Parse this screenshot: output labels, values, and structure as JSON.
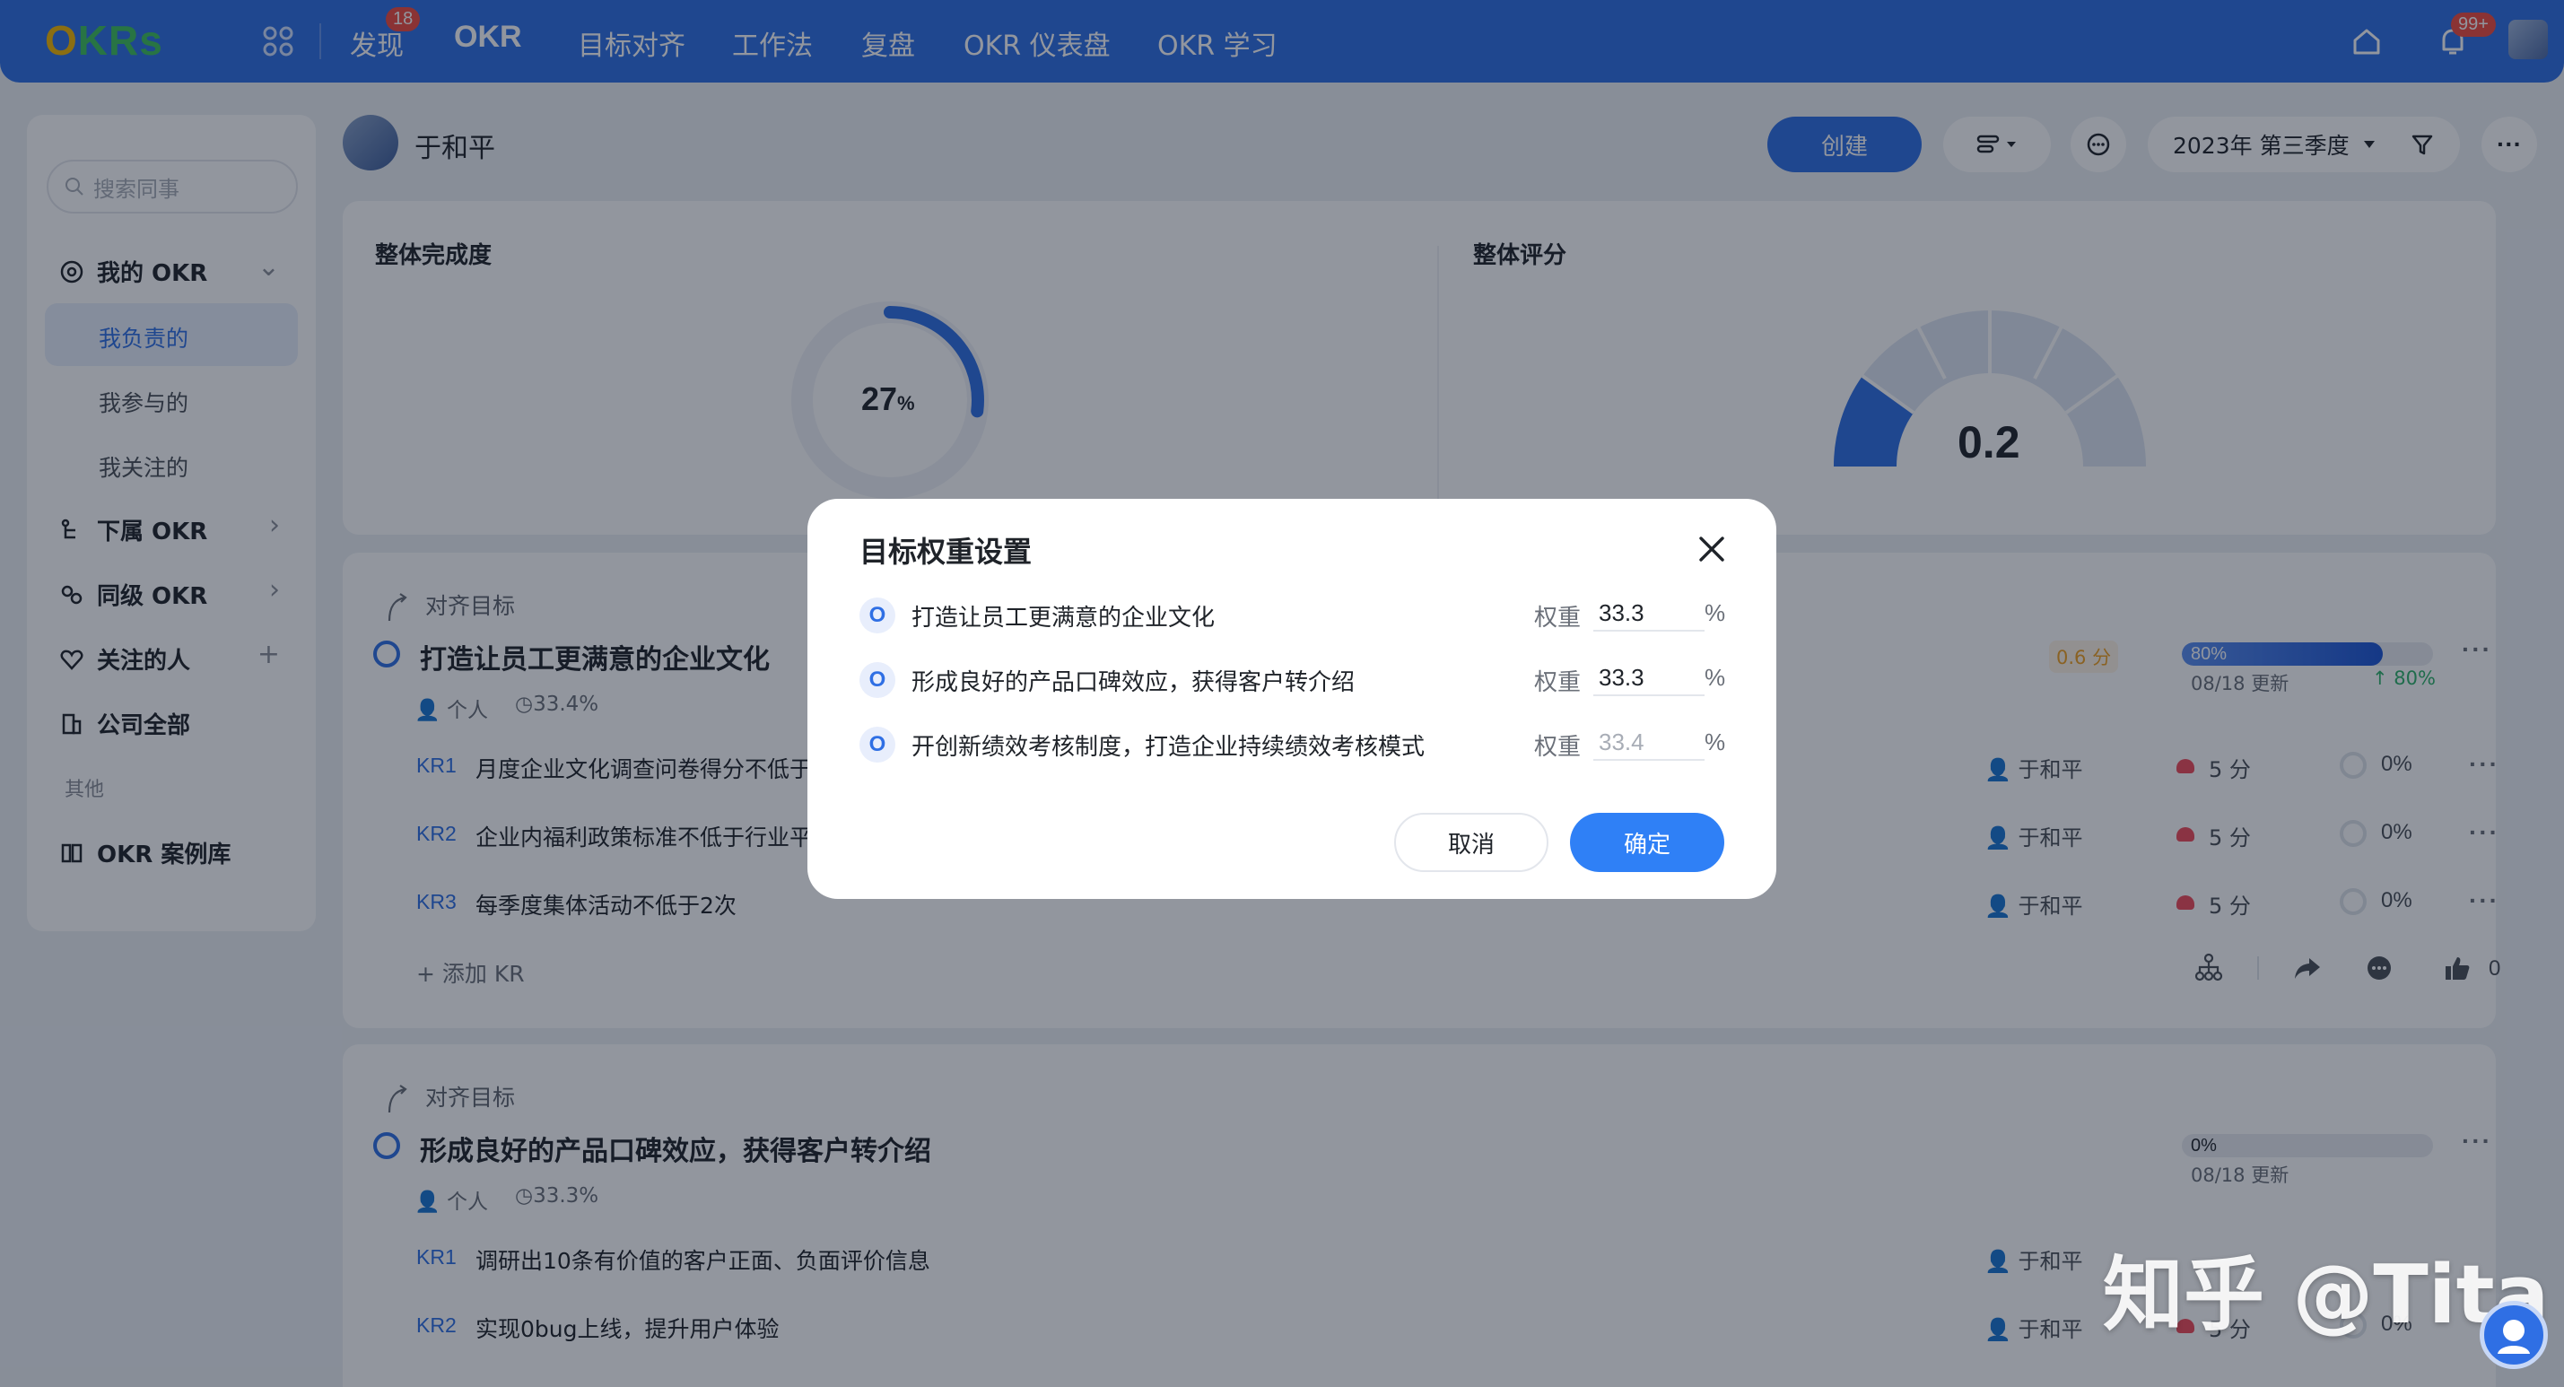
{
  "nav": {
    "logo": "OKRs",
    "items": [
      "发现",
      "OKR",
      "目标对齐",
      "工作法",
      "复盘",
      "OKR 仪表盘",
      "OKR 学习"
    ],
    "discover_badge": "18",
    "bell_badge": "99+"
  },
  "sidebar": {
    "search_placeholder": "搜索同事",
    "my_okr": "我的 OKR",
    "my_okr_sub": [
      "我负责的",
      "我参与的",
      "我关注的"
    ],
    "subordinate_okr": "下属 OKR",
    "peer_okr": "同级 OKR",
    "followed_people": "关注的人",
    "company_all": "公司全部",
    "others_label": "其他",
    "okr_cases": "OKR 案例库"
  },
  "header": {
    "user_name": "于和平",
    "create_label": "创建",
    "period": "2023年 第三季度"
  },
  "summary": {
    "completion_title": "整体完成度",
    "completion_value": "27",
    "completion_unit": "%",
    "completion_fraction": 0.27,
    "score_title": "整体评分",
    "score_value": "0.2"
  },
  "objectives": [
    {
      "align_label": "对齐目标",
      "title": "打造让员工更满意的企业文化",
      "owner_type": "个人",
      "weight": "33.4%",
      "score_chip": "0.6 分",
      "progress_label": "80%",
      "progress_fraction": 0.8,
      "update": "08/18 更新",
      "trend": "↑ 80%",
      "krs": [
        {
          "tag": "KR1",
          "text": "月度企业文化调查问卷得分不低于",
          "owner": "于和平",
          "score": "5 分",
          "pct": "0%"
        },
        {
          "tag": "KR2",
          "text": "企业内福利政策标准不低于行业平",
          "owner": "于和平",
          "score": "5 分",
          "pct": "0%"
        },
        {
          "tag": "KR3",
          "text": "每季度集体活动不低于2次",
          "owner": "于和平",
          "score": "5 分",
          "pct": "0%"
        }
      ],
      "add_kr": "添加 KR",
      "like_count": "0"
    },
    {
      "align_label": "对齐目标",
      "title": "形成良好的产品口碑效应，获得客户转介绍",
      "owner_type": "个人",
      "weight": "33.3%",
      "progress_label": "0%",
      "progress_fraction": 0,
      "update": "08/18 更新",
      "krs": [
        {
          "tag": "KR1",
          "text": "调研出10条有价值的客户正面、负面评价信息",
          "owner": "于和平",
          "score": "",
          "pct": ""
        },
        {
          "tag": "KR2",
          "text": "实现0bug上线，提升用户体验",
          "owner": "于和平",
          "score": "5 分",
          "pct": "0%"
        }
      ]
    }
  ],
  "dialog": {
    "title": "目标权重设置",
    "weight_label": "权重",
    "percent": "%",
    "rows": [
      {
        "icon": "O",
        "objective": "打造让员工更满意的企业文化",
        "value": "33.3",
        "placeholder": ""
      },
      {
        "icon": "O",
        "objective": "形成良好的产品口碑效应，获得客户转介绍",
        "value": "33.3",
        "placeholder": ""
      },
      {
        "icon": "O",
        "objective": "开创新绩效考核制度，打造企业持续绩效考核模式",
        "value": "",
        "placeholder": "33.4"
      }
    ],
    "cancel": "取消",
    "confirm": "确定"
  },
  "watermark": "知乎 @Tita",
  "colors": {
    "primary": "#2f6fe4",
    "confirm": "#2f80f6",
    "badge": "#f04b3f"
  }
}
